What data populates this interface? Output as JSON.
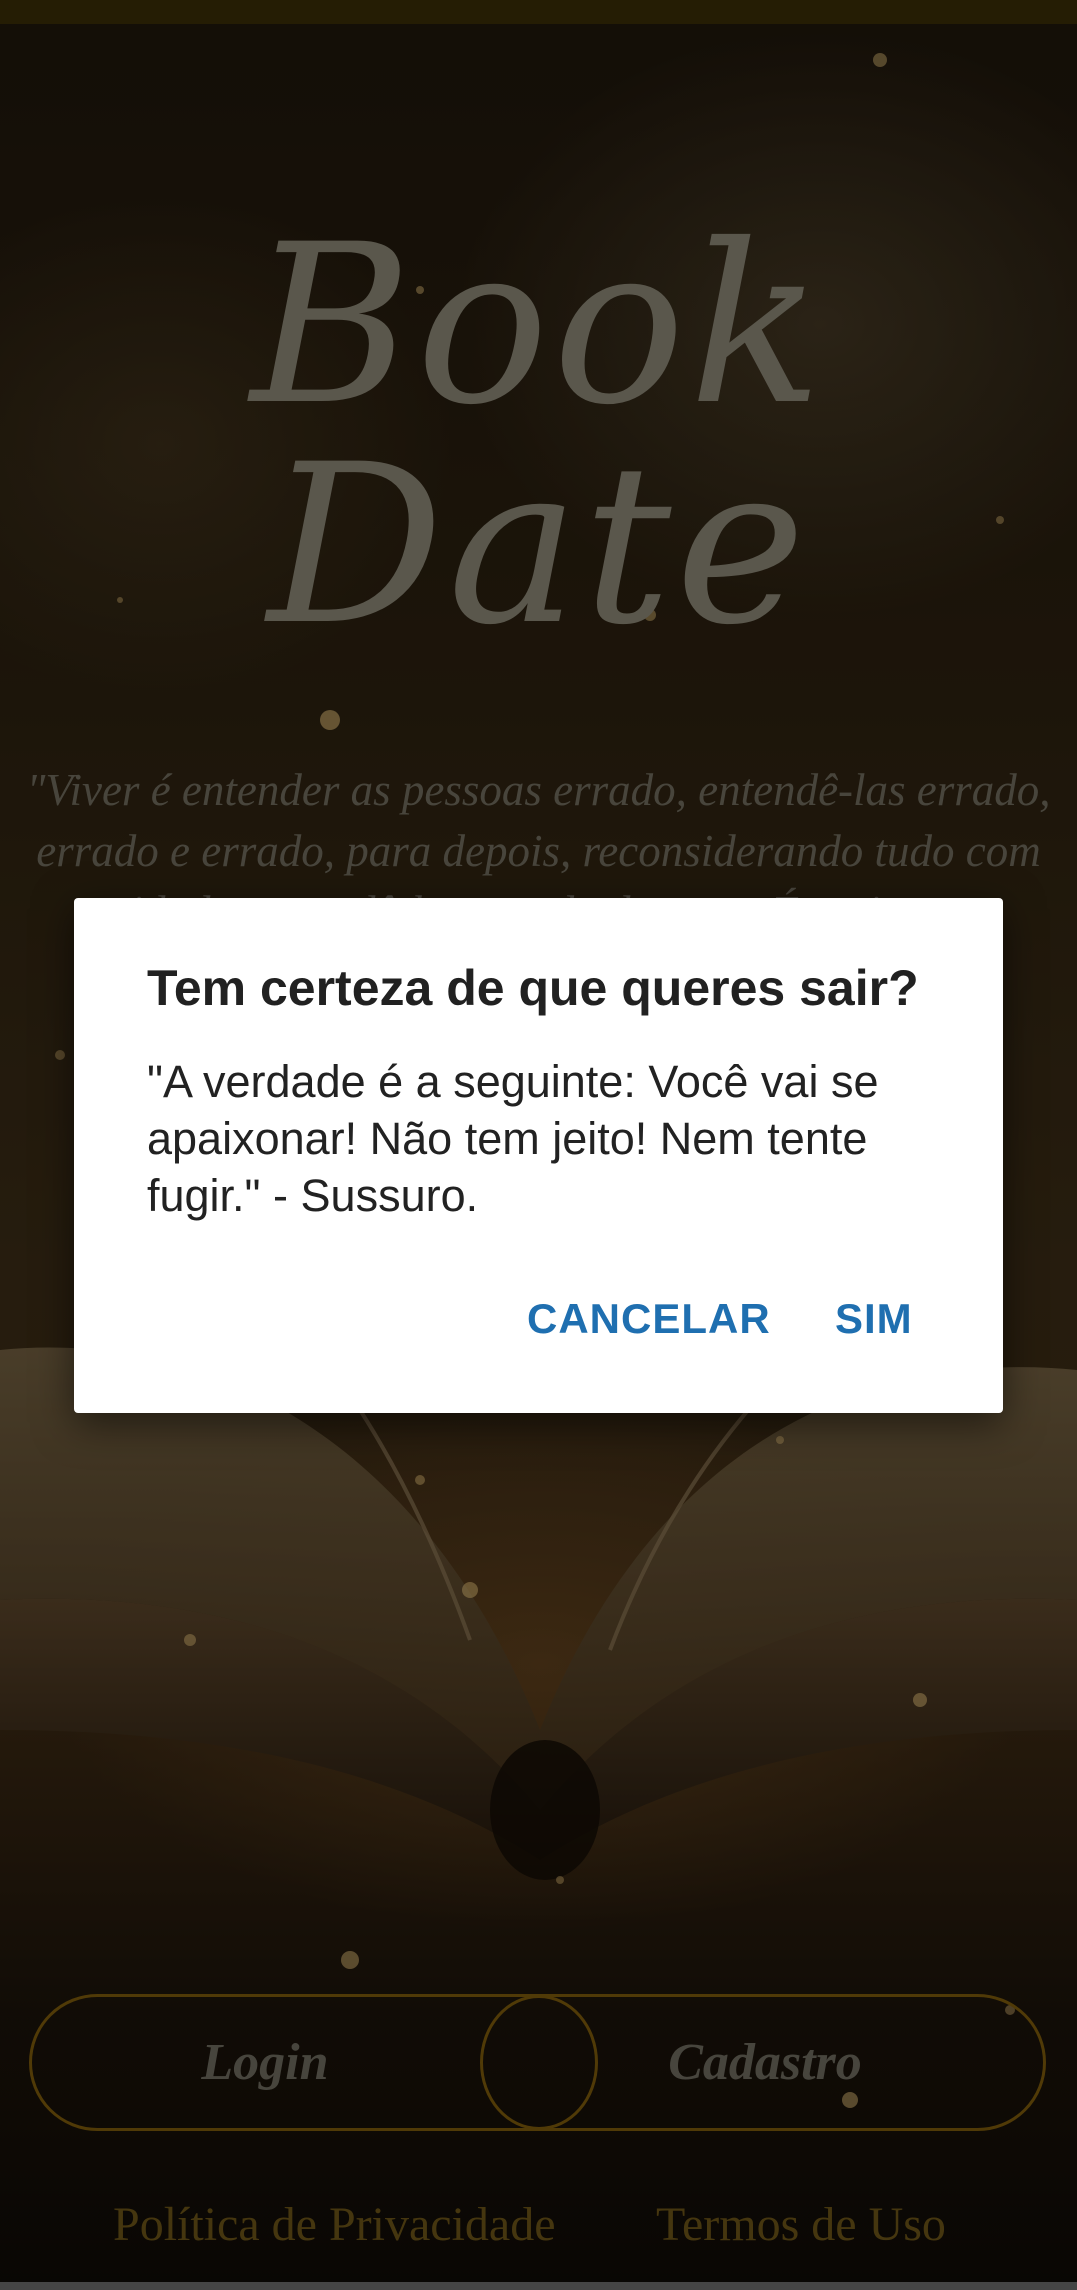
{
  "app": {
    "logo_text": "Book Date",
    "quote": "\"Viver é entender as pessoas errado, entendê-las errado, errado e errado, para depois, reconsiderando tudo com cuidado, entendê-las errado de novo. É assim que sabemos que estamos vivos:"
  },
  "auth": {
    "login_label": "Login",
    "signup_label": "Cadastro"
  },
  "footer": {
    "privacy_label": "Política de Privacidade",
    "terms_label": "Termos de Uso"
  },
  "dialog": {
    "title": "Tem certeza de que queres sair?",
    "message": "\"A verdade é a seguinte: Você vai se apaixonar! Não tem jeito! Nem tente fugir.\" - Sussuro.",
    "cancel_label": "CANCELAR",
    "confirm_label": "SIM"
  },
  "colors": {
    "accent": "#1f6fb0",
    "gold": "#7c5a0c",
    "background": "#2c2110"
  }
}
